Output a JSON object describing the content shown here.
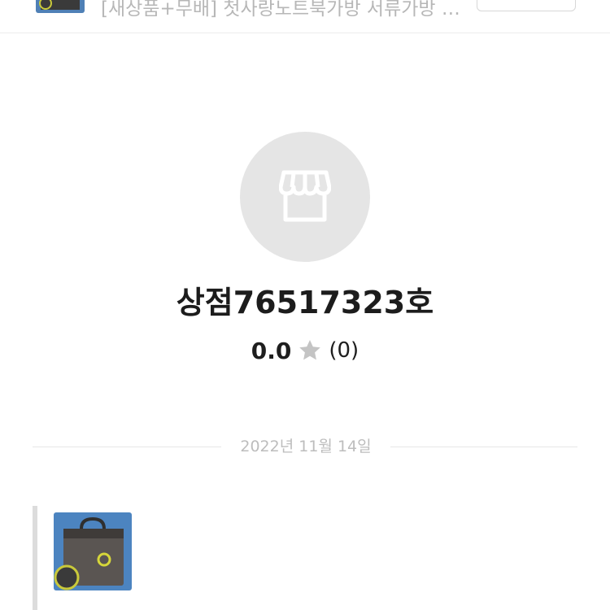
{
  "header": {
    "product_title": "[새상품+무배] 첫사랑노트북가방 서류가방 브...",
    "product_thumbnail_icon": "laptop-bag-icon",
    "action_button_label": ""
  },
  "shop": {
    "avatar_icon": "storefront-icon",
    "name": "상점76517323호",
    "rating": "0.0",
    "review_count": "(0)",
    "star_icon": "star-icon"
  },
  "chat": {
    "date_label": "2022년 11월 14일",
    "message_image_icon": "laptop-bag-icon"
  },
  "colors": {
    "avatar_bg": "#e5e5e5",
    "star": "#c4c4c4",
    "divider": "#e6e6e6",
    "muted_text": "#bdbdbd"
  }
}
